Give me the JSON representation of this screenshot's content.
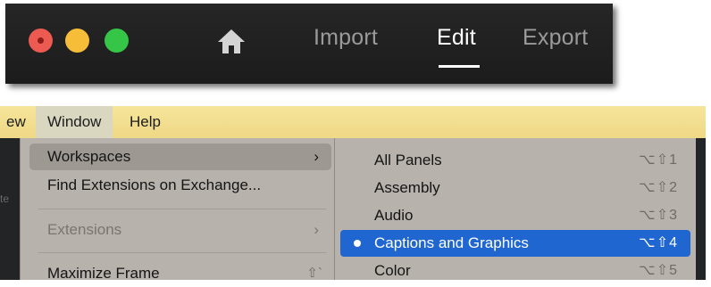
{
  "header": {
    "nav": {
      "import": "Import",
      "edit": "Edit",
      "export": "Export"
    },
    "active_tab": "Edit"
  },
  "menubar": {
    "view_partial": "ew",
    "window": "Window",
    "help": "Help"
  },
  "background_fragment": "te",
  "window_menu": {
    "items": [
      {
        "label": "Workspaces",
        "submenu": true,
        "highlighted": true
      },
      {
        "label": "Find Extensions on Exchange..."
      },
      {
        "label": "Extensions",
        "submenu": true,
        "disabled": true
      },
      {
        "label": "Maximize Frame",
        "shortcut": "⇧`"
      }
    ]
  },
  "workspaces_submenu": {
    "items": [
      {
        "label": "All Panels",
        "shortcut": "⌥⇧1"
      },
      {
        "label": "Assembly",
        "shortcut": "⌥⇧2"
      },
      {
        "label": "Audio",
        "shortcut": "⌥⇧3"
      },
      {
        "label": "Captions and Graphics",
        "shortcut": "⌥⇧4",
        "selected": true,
        "checked": true
      },
      {
        "label": "Color",
        "shortcut": "⌥⇧5"
      }
    ]
  },
  "colors": {
    "header_bg": "#1f1f1f",
    "traffic_red": "#ec5a52",
    "traffic_yellow": "#f6be38",
    "traffic_green": "#35c647",
    "menubar_bg": "#f3e08f",
    "menu_bg": "#b7b2ac",
    "selection_blue": "#1f66d1"
  },
  "icons": {
    "home": "home-icon",
    "submenu": "chevron-right-icon",
    "checked": "bullet-dot-icon"
  }
}
